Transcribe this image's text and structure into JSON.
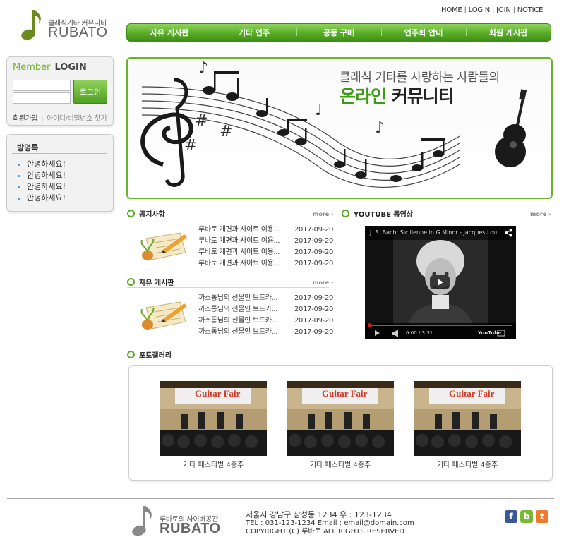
{
  "header": {
    "logo_sub": "클래식기타 커뮤니티",
    "logo_main": "RUBATO",
    "top_links": [
      "HOME",
      "LOGIN",
      "JOIN",
      "NOTICE"
    ],
    "nav": [
      "자유 게시판",
      "기타 연주",
      "공동 구매",
      "연주회 안내",
      "회원 게시판"
    ],
    "accent": "#5aa826"
  },
  "login": {
    "title_a": "Member",
    "title_b": "LOGIN",
    "button": "로그인",
    "join": "회원가입",
    "find": "아이디/비밀번호 찾기"
  },
  "guestbook": {
    "title": "방명록",
    "items": [
      "안녕하세요!",
      "안녕하세요!",
      "안녕하세요!",
      "안녕하세요!"
    ]
  },
  "banner": {
    "sub": "클래식 기타를 사랑하는 사람들의",
    "main_green": "온라인",
    "main_black": "커뮤니티"
  },
  "notice": {
    "title": "공지사항",
    "more": "more ›",
    "posts": [
      {
        "title": "루바토 개편과 사이트 이용...",
        "date": "2017-09-20"
      },
      {
        "title": "루바토 개편과 사이트 이용...",
        "date": "2017-09-20"
      },
      {
        "title": "루바토 개편과 사이트 이용...",
        "date": "2017-09-20"
      },
      {
        "title": "루바토 개편과 사이트 이용...",
        "date": "2017-09-20"
      }
    ]
  },
  "free_board": {
    "title": "자유 게시판",
    "more": "more ›",
    "posts": [
      {
        "title": "까스통님의 선물인 보드카...",
        "date": "2017-09-20"
      },
      {
        "title": "까스통님의 선물인 보드카...",
        "date": "2017-09-20"
      },
      {
        "title": "까스통님의 선물인 보드카...",
        "date": "2017-09-20"
      },
      {
        "title": "까스통님의 선물인 보드카...",
        "date": "2017-09-20"
      }
    ]
  },
  "youtube": {
    "title": "YOUTUBE 동영상",
    "more": "more ›",
    "video_title": "J. S. Bach: Sicilienne in G Minor - Jacques Lou...",
    "time": "0:00 / 3:31",
    "logo": "YouTube"
  },
  "gallery": {
    "title": "포토갤러리",
    "sign": "Guitar Fair",
    "items": [
      {
        "caption": "기타 페스티벌 4중주"
      },
      {
        "caption": "기타 페스티벌 4중주"
      },
      {
        "caption": "기타 페스티벌 4중주"
      }
    ]
  },
  "footer": {
    "logo_sub": "루바토의 사이버공간",
    "logo_main": "RUBATO",
    "address": "서울시 강남구 삼성동 1234 우 : 123-1234",
    "contact": "TEL : 031-123-1234  Email : email@domain.com",
    "copyright": "COPYRIGHT (C) 루바토 ALL RIGHTS RESERVED",
    "sns": [
      {
        "label": "f",
        "color": "#3b5998"
      },
      {
        "label": "b",
        "color": "#7ab835"
      },
      {
        "label": "t",
        "color": "#f07a2b"
      }
    ]
  }
}
